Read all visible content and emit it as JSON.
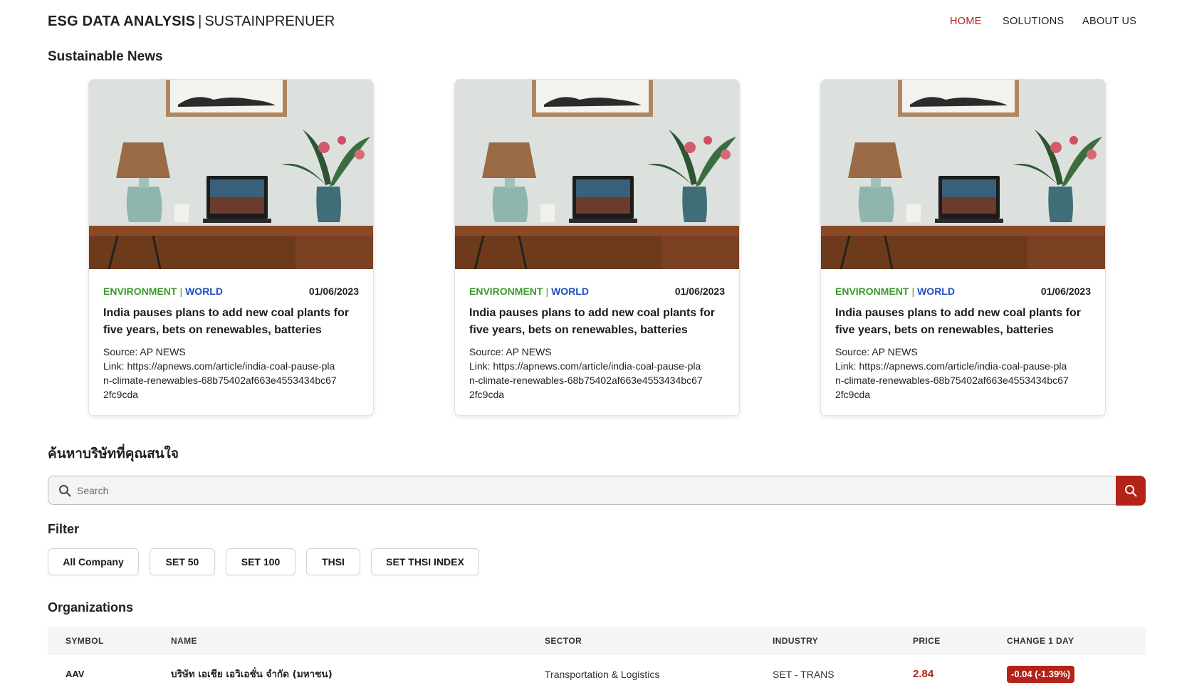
{
  "header": {
    "brand_strong": "ESG DATA ANALYSIS",
    "brand_sep": "|",
    "brand_sub": "SUSTAINPRENUER",
    "nav": [
      "HOME",
      "SOLUTIONS",
      "ABOUT US"
    ]
  },
  "news": {
    "title": "Sustainable News",
    "cards": [
      {
        "category1": "ENVIRONMENT",
        "separator": "|",
        "category2": "WORLD",
        "date": "01/06/2023",
        "headline": "India pauses plans to add new coal plants for five years, bets on renewables, batteries",
        "source": "Source: AP NEWS",
        "link": "Link: https://apnews.com/article/india-coal-pause-plan-climate-renewables-68b75402af663e4553434bc672fc9cda"
      },
      {
        "category1": "ENVIRONMENT",
        "separator": "|",
        "category2": "WORLD",
        "date": "01/06/2023",
        "headline": "India pauses plans to add new coal plants for five years, bets on renewables, batteries",
        "source": "Source: AP NEWS",
        "link": "Link: https://apnews.com/article/india-coal-pause-plan-climate-renewables-68b75402af663e4553434bc672fc9cda"
      },
      {
        "category1": "ENVIRONMENT",
        "separator": "|",
        "category2": "WORLD",
        "date": "01/06/2023",
        "headline": "India pauses plans to add new coal plants for five years, bets on renewables, batteries",
        "source": "Source: AP NEWS",
        "link": "Link: https://apnews.com/article/india-coal-pause-plan-climate-renewables-68b75402af663e4553434bc672fc9cda"
      }
    ]
  },
  "search": {
    "title": "ค้นหาบริษัทที่คุณสนใจ",
    "placeholder": "Search"
  },
  "filter": {
    "title": "Filter",
    "options": [
      "All Company",
      "SET 50",
      "SET 100",
      "THSI",
      "SET THSI INDEX"
    ]
  },
  "organizations": {
    "title": "Organizations",
    "columns": [
      "SYMBOL",
      "NAME",
      "SECTOR",
      "INDUSTRY",
      "PRICE",
      "CHANGE 1 DAY"
    ],
    "rows": [
      {
        "symbol": "AAV",
        "name": "บริษัท เอเชีย เอวิเอชั่น จำกัด (มหาชน)",
        "sector": "Transportation & Logistics",
        "industry": "SET - TRANS",
        "price": "2.84",
        "change": "-0.04 (-1.39%)"
      }
    ]
  },
  "colors": {
    "accent": "#b32319",
    "environment": "#3a9c2a",
    "world": "#1d4fbf"
  }
}
